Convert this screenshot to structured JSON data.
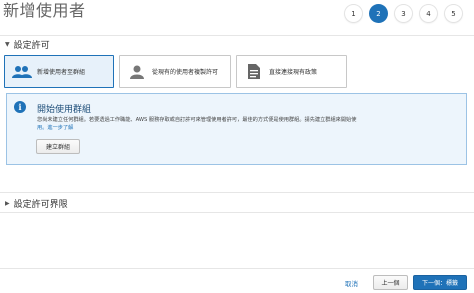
{
  "page": {
    "title": "新增使用者"
  },
  "steps": [
    "1",
    "2",
    "3",
    "4",
    "5"
  ],
  "active_step": "2",
  "permissions_section": {
    "title": "設定許可",
    "options": [
      {
        "label": "新增使用者至群組",
        "icon": "users-group-icon",
        "selected": true
      },
      {
        "label": "從現有的使用者複製許可",
        "icon": "user-icon",
        "selected": false
      },
      {
        "label": "直接連接現有政策",
        "icon": "document-icon",
        "selected": false
      }
    ]
  },
  "info_box": {
    "title": "開始使用群組",
    "body_line1": "您尚未建立任何群組。若要透過工作職能、AWS 服務存取或自訂許可來管理使用者許可，最佳的方式便是使用群組。請先建立群組來開始使",
    "body_line2": "用。進一步了解",
    "create_group_label": "建立群組"
  },
  "boundary_section": {
    "title": "設定許可界限"
  },
  "footer": {
    "cancel_label": "取消",
    "previous_label": "上一個",
    "next_label": "下一個：標籤"
  },
  "colors": {
    "accent": "#1f72b8",
    "info_bg": "#edf5fc",
    "info_border": "#9cc3e5"
  }
}
